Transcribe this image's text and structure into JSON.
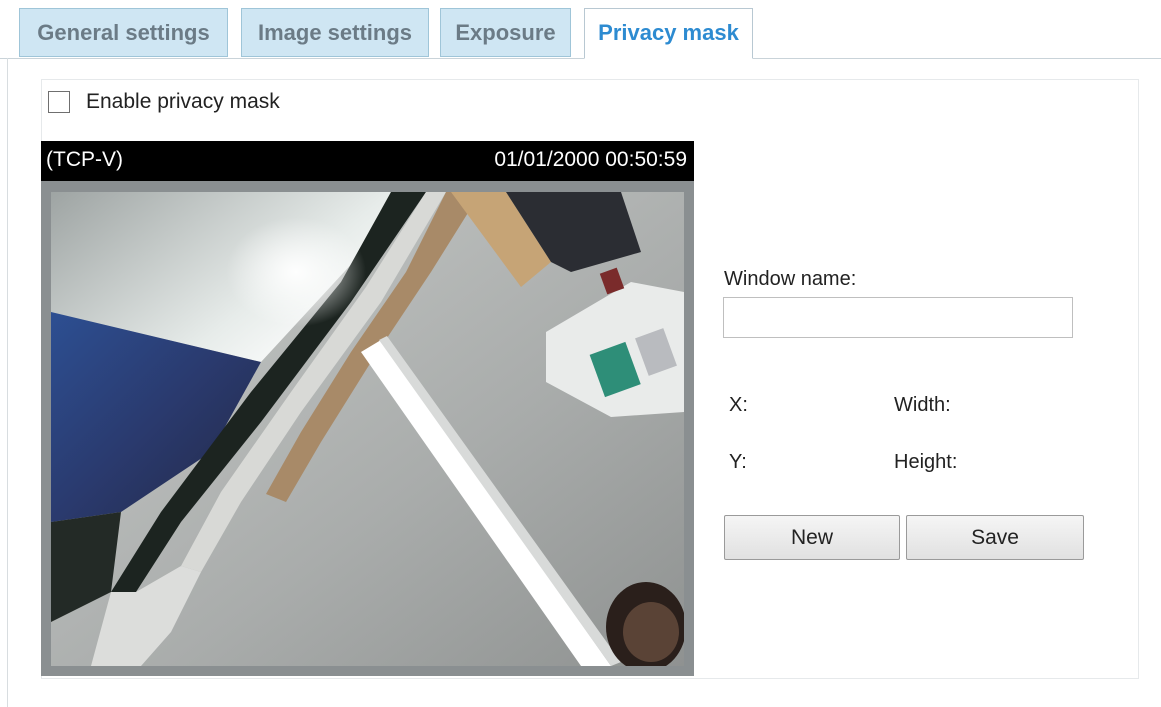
{
  "tabs": [
    {
      "label": "General settings",
      "active": false
    },
    {
      "label": "Image settings",
      "active": false
    },
    {
      "label": "Exposure",
      "active": false
    },
    {
      "label": "Privacy mask",
      "active": true
    }
  ],
  "privacy_mask": {
    "enable_label": "Enable privacy mask",
    "enabled": false
  },
  "viewer": {
    "stream": "(TCP-V)",
    "timestamp": "01/01/2000 00:50:59"
  },
  "form": {
    "window_name_label": "Window name:",
    "window_name_value": "",
    "x_label": "X:",
    "y_label": "Y:",
    "width_label": "Width:",
    "height_label": "Height:",
    "new_label": "New",
    "save_label": "Save"
  },
  "colors": {
    "active_tab_text": "#2d8bd1",
    "tab_background": "#cfe6f3",
    "viewer_bar": "#000000"
  }
}
